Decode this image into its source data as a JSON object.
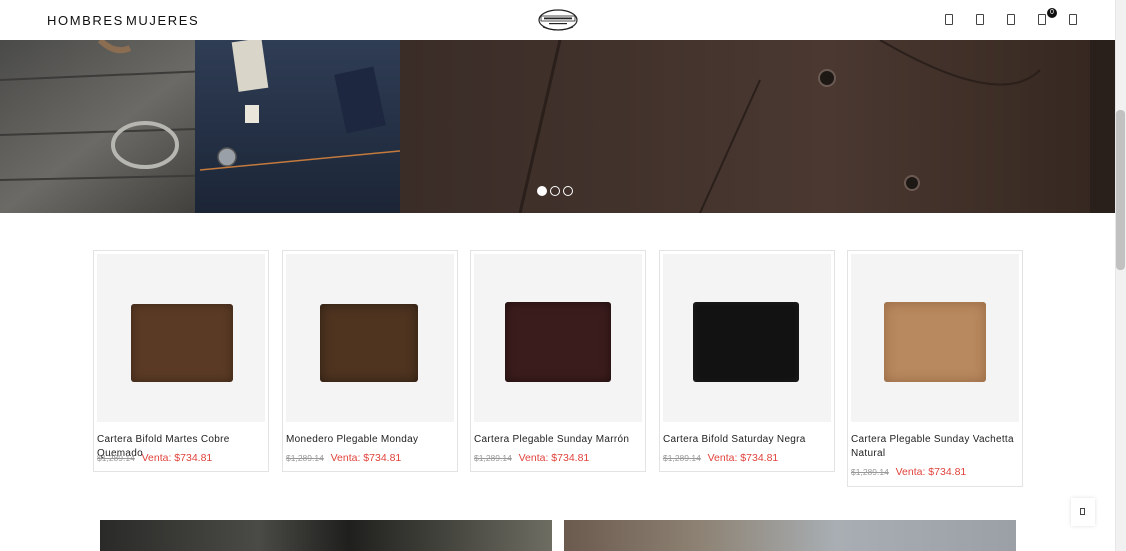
{
  "header": {
    "nav": [
      {
        "label": "HOMBRES"
      },
      {
        "label": "MUJERES"
      }
    ],
    "logo_icon": "thursday-boot-co-logo",
    "icons": [
      "search-icon",
      "account-icon",
      "wishlist-icon",
      "cart-icon",
      "menu-icon"
    ],
    "cart_count": "0"
  },
  "hero": {
    "slides": 3,
    "active_slide": 1
  },
  "products": [
    {
      "title": "Cartera Bifold Martes Cobre Quemado",
      "original_price": "$1,289.14",
      "sale_price": "Venta: $734.81",
      "color": "#5a3a24"
    },
    {
      "title": "Monedero Plegable Monday",
      "original_price": "$1,289.14",
      "sale_price": "Venta: $734.81",
      "color": "#4f3420"
    },
    {
      "title": "Cartera Plegable Sunday Marrón",
      "original_price": "$1,289.14",
      "sale_price": "Venta: $734.81",
      "color": "#3b1c1c"
    },
    {
      "title": "Cartera Bifold Saturday Negra",
      "original_price": "$1,289.14",
      "sale_price": "Venta: $734.81",
      "color": "#121212"
    },
    {
      "title": "Cartera Plegable Sunday Vachetta Natural",
      "original_price": "$1,289.14",
      "sale_price": "Venta: $734.81",
      "color": "#b8885e"
    }
  ],
  "colors": {
    "sale": "#e0433c",
    "strikethrough": "#999999"
  }
}
